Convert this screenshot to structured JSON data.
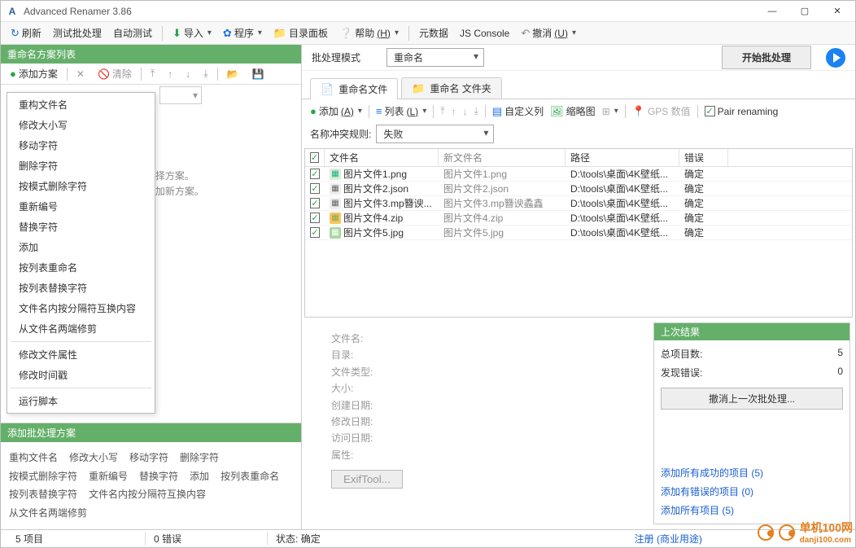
{
  "titlebar": {
    "title": "Advanced Renamer 3.86"
  },
  "toolbar": {
    "refresh": "刷新",
    "test_batch": "测试批处理",
    "auto_test": "自动测试",
    "import": "导入",
    "program": "程序",
    "folder_panel": "目录面板",
    "help": "帮助",
    "help_key": "(H)",
    "metadata": "元数据",
    "js_console": "JS Console",
    "undo": "撤消",
    "undo_key": "(U)"
  },
  "left": {
    "header": "重命名方案列表",
    "add_method": "添加方案",
    "clear": "清除",
    "hint1": "'添加方案' 来选择方案。",
    "hint2": "'添加方案' 来添加新方案。",
    "batch_header": "添加批处理方案",
    "menu_items_1": [
      "重构文件名",
      "修改大小写",
      "移动字符",
      "删除字符",
      "按模式删除字符",
      "重新编号",
      "替换字符",
      "添加",
      "按列表重命名",
      "按列表替换字符",
      "文件名内按分隔符互换内容",
      "从文件名两端修剪"
    ],
    "menu_items_2": [
      "修改文件属性",
      "修改时间戳"
    ],
    "menu_items_3": [
      "运行脚本"
    ],
    "batch_links_1": [
      "重构文件名",
      "修改大小写",
      "移动字符",
      "删除字符"
    ],
    "batch_links_2": [
      "按模式删除字符",
      "重新编号",
      "替换字符",
      "添加",
      "按列表重命名"
    ],
    "batch_links_3": [
      "按列表替换字符",
      "文件名内按分隔符互换内容"
    ],
    "batch_links_4": [
      "从文件名两端修剪"
    ]
  },
  "right": {
    "mode_label": "批处理模式",
    "mode_value": "重命名",
    "start_btn": "开始批处理",
    "tab_files": "重命名文件",
    "tab_folders": "重命名 文件夹",
    "add_btn": "添加",
    "add_key": "(A)",
    "list_btn": "列表",
    "list_key": "(L)",
    "custom_col": "自定义列",
    "thumb": "缩略图",
    "gps": "GPS 数值",
    "pair": "Pair renaming",
    "conflict_label": "名称冲突规则:",
    "conflict_value": "失败",
    "col_filename": "文件名",
    "col_newname": "新文件名",
    "col_path": "路径",
    "col_error": "错误",
    "rows": [
      {
        "name": "图片文件1.png",
        "new": "图片文件1.png",
        "path": "D:\\tools\\桌面\\4K壁纸...",
        "err": "确定",
        "ico": "png"
      },
      {
        "name": "图片文件2.json",
        "new": "图片文件2.json",
        "path": "D:\\tools\\桌面\\4K壁纸...",
        "err": "确定",
        "ico": "json"
      },
      {
        "name": "图片文件3.mp簪谀...",
        "new": "图片文件3.mp簪谀蟊鑫",
        "path": "D:\\tools\\桌面\\4K壁纸...",
        "err": "确定",
        "ico": "mp"
      },
      {
        "name": "图片文件4.zip",
        "new": "图片文件4.zip",
        "path": "D:\\tools\\桌面\\4K壁纸...",
        "err": "确定",
        "ico": "zip"
      },
      {
        "name": "图片文件5.jpg",
        "new": "图片文件5.jpg",
        "path": "D:\\tools\\桌面\\4K壁纸...",
        "err": "确定",
        "ico": "jpg"
      }
    ],
    "props": {
      "filename": "文件名:",
      "dir": "目录:",
      "type": "文件类型:",
      "size": "大小:",
      "created": "创建日期:",
      "modified": "修改日期:",
      "accessed": "访问日期:",
      "attrs": "属性:",
      "exif": "ExifTool..."
    },
    "last_result": {
      "header": "上次结果",
      "total_label": "总项目数:",
      "total": "5",
      "errors_label": "发现错误:",
      "errors": "0",
      "undo": "撤消上一次批处理...",
      "link1": "添加所有成功的项目 (5)",
      "link2": "添加有错误的项目 (0)",
      "link3": "添加所有项目 (5)"
    }
  },
  "statusbar": {
    "items_count": "5 项目",
    "errors": "0 错误",
    "state_label": "状态:",
    "state": "确定",
    "register": "注册 (商业用途)"
  },
  "watermark": {
    "text": "单机100网",
    "sub": "danji100.com"
  }
}
